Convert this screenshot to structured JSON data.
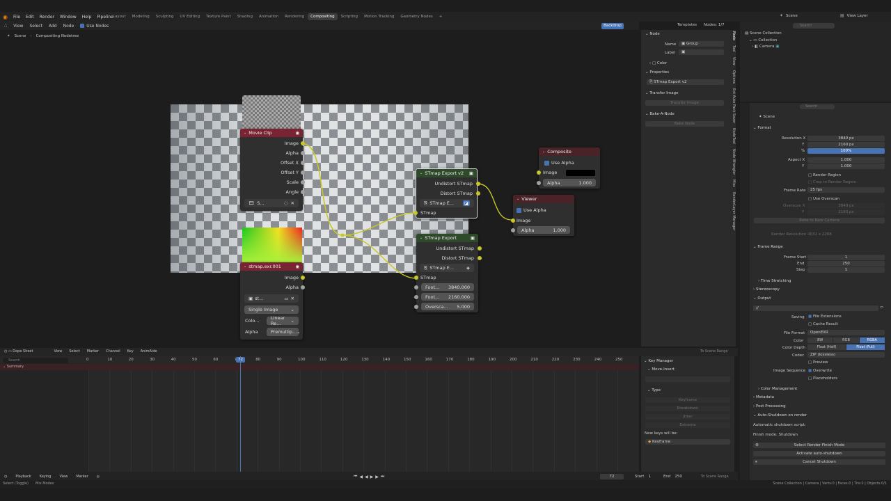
{
  "menu": [
    "File",
    "Edit",
    "Render",
    "Window",
    "Help",
    "Pipeline"
  ],
  "workspaces": [
    "Layout",
    "Modeling",
    "Sculpting",
    "UV Editing",
    "Texture Paint",
    "Shading",
    "Animation",
    "Rendering",
    "Compositing",
    "Scripting",
    "Motion Tracking",
    "Geometry Nodes"
  ],
  "active_workspace": "Compositing",
  "scene": "Scene",
  "view_layer": "View Layer",
  "node_header": {
    "items": [
      "View",
      "Select",
      "Add",
      "Node"
    ],
    "use_nodes": "Use Nodes",
    "backdrop": "Backdrop",
    "templates": "Templates",
    "nodes_count": "Nodes: 1/7"
  },
  "breadcrumb": [
    "Scene",
    "Compositing Nodetree"
  ],
  "nodes": {
    "movie_clip": {
      "title": "Movie Clip",
      "outputs": [
        "Image",
        "Alpha",
        "Offset X",
        "Offset Y",
        "Scale",
        "Angle"
      ],
      "clip": "S..."
    },
    "stmap_exr": {
      "title": "stmap.exr.001",
      "outputs": [
        "Image",
        "Alpha"
      ],
      "file": "st...",
      "source": "Single Image",
      "color_label": "Colo...",
      "color_value": "Linear Re...",
      "alpha_label": "Alpha",
      "alpha_value": "Premultip..."
    },
    "stmap_export_v2": {
      "title": "STmap Export v2",
      "outputs": [
        "Undistort STmap",
        "Distort STmap"
      ],
      "group": "STmap E...",
      "input": "STmap"
    },
    "stmap_export": {
      "title": "STmap Export",
      "outputs": [
        "Undistort STmap",
        "Distort STmap"
      ],
      "group": "STmap E...",
      "input": "STmap",
      "fields": [
        {
          "label": "Foot...",
          "value": "3840.000"
        },
        {
          "label": "Foot...",
          "value": "2160.000"
        },
        {
          "label": "Oversca...",
          "value": "5.000"
        }
      ]
    },
    "composite": {
      "title": "Composite",
      "use_alpha": "Use Alpha",
      "image": "Image",
      "alpha_label": "Alpha",
      "alpha_value": "1.000"
    },
    "viewer": {
      "title": "Viewer",
      "use_alpha": "Use Alpha",
      "image": "Image",
      "alpha_label": "Alpha",
      "alpha_value": "1.000"
    }
  },
  "n_panel": {
    "section_node": "Node",
    "name_label": "Name",
    "name_value": "Group",
    "label_label": "Label",
    "color": "Color",
    "properties": "Properties",
    "group_value": "STmap Export v2",
    "transfer_image": "Transfer Image",
    "transfer_button": "Transfer Image",
    "bake_a_node": "Bake-A-Node",
    "bake_button": "Bake Node"
  },
  "side_tabs": [
    "Node",
    "Tool",
    "View",
    "Options",
    "Ext Auto Pack Saver",
    "NodeTool",
    "Node Wrangler",
    "Misc",
    "RenderLayer Manager"
  ],
  "outliner": {
    "items": [
      "Scene Collection",
      "Collection",
      "Camera"
    ],
    "search_placeholder": "Search"
  },
  "props": {
    "scene": "Scene",
    "search_placeholder": "Search",
    "format": "Format",
    "resolution_x_label": "Resolution X",
    "resolution_x": "3840 px",
    "y_label": "Y",
    "resolution_y": "2160 px",
    "pct_label": "%",
    "pct": "100%",
    "aspect_x_label": "Aspect X",
    "aspect_x": "1.000",
    "aspect_y_label": "Y",
    "aspect_y": "1.000",
    "render_region": "Render Region",
    "crop": "Crop to Render Region",
    "frame_rate_label": "Frame Rate",
    "frame_rate": "25 fps",
    "use_overscan": "Use Overscan",
    "overscan_x_label": "Overscan X",
    "overscan_x": "3840 px",
    "overscan_y_label": "Y",
    "overscan_y": "2160 px",
    "bake_camera": "Bake to New Camera",
    "render_resolution_label": "Render Resolution",
    "render_resolution": "4032 x 2268",
    "frame_range": "Frame Range",
    "frame_start_label": "Frame Start",
    "frame_start": "1",
    "end_label": "End",
    "end": "250",
    "step_label": "Step",
    "step": "1",
    "time_stretching": "Time Stretching",
    "stereoscopy": "Stereoscopy",
    "output": "Output",
    "output_path": "//",
    "saving_label": "Saving",
    "file_extensions": "File Extensions",
    "cache_result": "Cache Result",
    "file_format_label": "File Format",
    "file_format": "OpenEXR",
    "color_label": "Color",
    "color_options": [
      "BW",
      "RGB",
      "RGBA"
    ],
    "color_active": "RGBA",
    "color_depth_label": "Color Depth",
    "depth_options": [
      "Float (Half)",
      "Float (Full)"
    ],
    "depth_active": "Float (Full)",
    "codec_label": "Codec",
    "codec": "ZIP (lossless)",
    "preview": "Preview",
    "image_sequence_label": "Image Sequence",
    "overwrite": "Overwrite",
    "placeholders": "Placeholders",
    "color_management": "Color Management",
    "metadata": "Metadata",
    "post_processing": "Post Processing",
    "auto_shutdown": "Auto-Shutdown on render",
    "auto_script": "Automatic shutdown script:",
    "finish_mode": "Finish mode: Shutdown",
    "select_finish": "Select Render Finish Mode",
    "activate": "Activate auto-shutdown",
    "cancel": "Cancel Shutdown"
  },
  "dope": {
    "mode": "Dope Sheet",
    "menus": [
      "View",
      "Select",
      "Marker",
      "Channel",
      "Key",
      "AnimAide"
    ],
    "to_scene_range": "To Scene Range",
    "search_placeholder": "Search",
    "summary": "Summary",
    "current_frame": "72",
    "frame_ticks": [
      "0",
      "10",
      "20",
      "30",
      "40",
      "50",
      "60",
      "70",
      "80",
      "90",
      "100",
      "110",
      "120",
      "130",
      "140",
      "150",
      "160",
      "170",
      "180",
      "190",
      "200",
      "210",
      "220",
      "230",
      "240",
      "250"
    ]
  },
  "key_panel": {
    "title": "Key Manager",
    "move_insert": "Move-Insert",
    "type": "Type",
    "types": [
      "Keyframe",
      "Breakdown",
      "Jitter",
      "Extreme"
    ],
    "new_keys": "New keys will be:",
    "new_key_value": "Keyframe"
  },
  "timeline": {
    "menus": [
      "Playback",
      "Keying",
      "View",
      "Marker"
    ],
    "frame": "72",
    "start_label": "Start",
    "start": "1",
    "end_label": "End",
    "end": "250",
    "to_scene_range": "To Scene Range"
  },
  "status": {
    "left": "Select (Toggle)",
    "middle": "Mix Modes",
    "right": "Scene Collection | Camera | Verts:0 | Faces:0 | Tris:0 | Objects:0/1"
  },
  "colors": {
    "movie_clip_head": "#7a2332",
    "group_head": "#2f4a2a",
    "output_head": "#4a2328",
    "link": "#c7c729",
    "accent": "#4772b3"
  }
}
